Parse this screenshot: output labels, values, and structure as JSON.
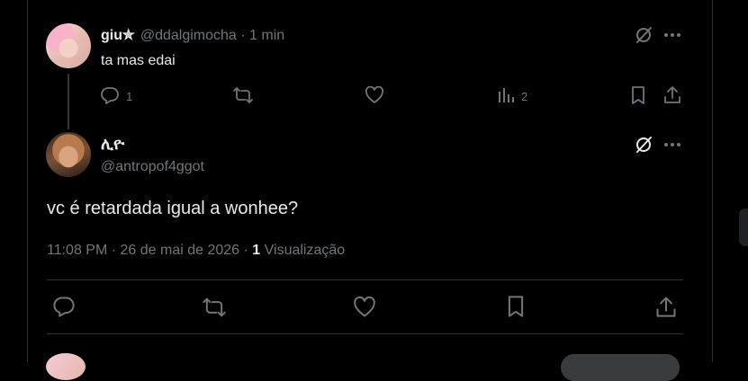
{
  "reply": {
    "author_name": "giu✮",
    "handle": "@ddalgimocha",
    "time": "· 1 min",
    "text": "ta mas edai",
    "reply_count": "1",
    "views_count": "2"
  },
  "main": {
    "author_name": "ሊዮ",
    "handle": "@antropof4ggot",
    "text": "vc é retardada igual a wonhee?",
    "timestamp": "11:08 PM · 26 de mai de 2026 · ",
    "views_count": "1",
    "views_label": " Visualização"
  },
  "icons": {
    "reply": "reply-icon",
    "retweet": "retweet-icon",
    "like": "heart-icon",
    "views": "views-icon",
    "bookmark": "bookmark-icon",
    "share": "share-icon",
    "grok": "grok-icon",
    "more": "more-icon"
  }
}
